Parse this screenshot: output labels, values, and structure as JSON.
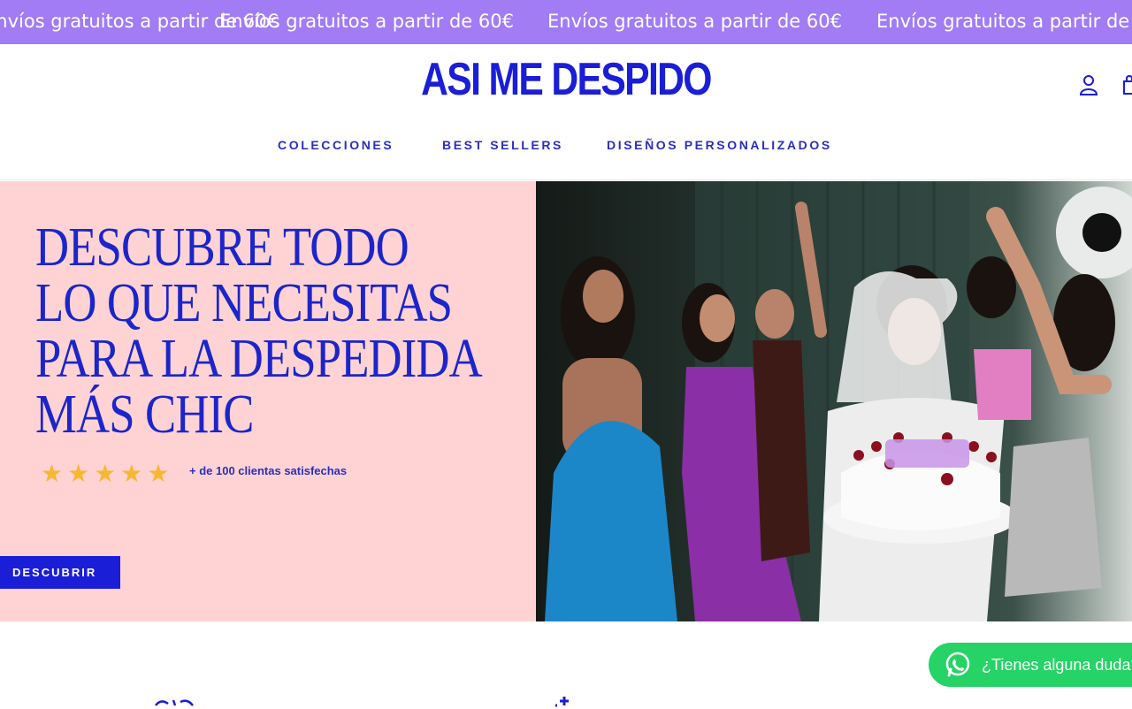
{
  "announcement": {
    "text": "Envíos gratuitos a partir de 60€",
    "repeat_count": 4
  },
  "header": {
    "logo": "ASI ME DESPIDO",
    "icons": [
      "account-icon",
      "cart-icon"
    ]
  },
  "nav": {
    "items": [
      {
        "label": "COLECCIONES"
      },
      {
        "label": "BEST SELLERS"
      },
      {
        "label": "DISEÑOS PERSONALIZADOS"
      }
    ]
  },
  "hero": {
    "title_lines": [
      "DESCUBRE TODO",
      "LO QUE NECESITAS",
      "PARA LA DESPEDIDA",
      "MÁS CHIC"
    ],
    "rating": {
      "stars": 5,
      "text": "+ de 100 clientas satisfechas"
    },
    "cta_label": "DESCUBRIR",
    "image_description_icon": "party-photo"
  },
  "whatsapp": {
    "text": "¿Tienes alguna duda?",
    "icon": "whatsapp-icon"
  },
  "colors": {
    "ticker_bg": "#a17cf5",
    "brand_blue": "#1a1ed6",
    "hero_pink": "#ffd3d4",
    "star": "#f7b731",
    "whatsapp": "#25d366"
  }
}
